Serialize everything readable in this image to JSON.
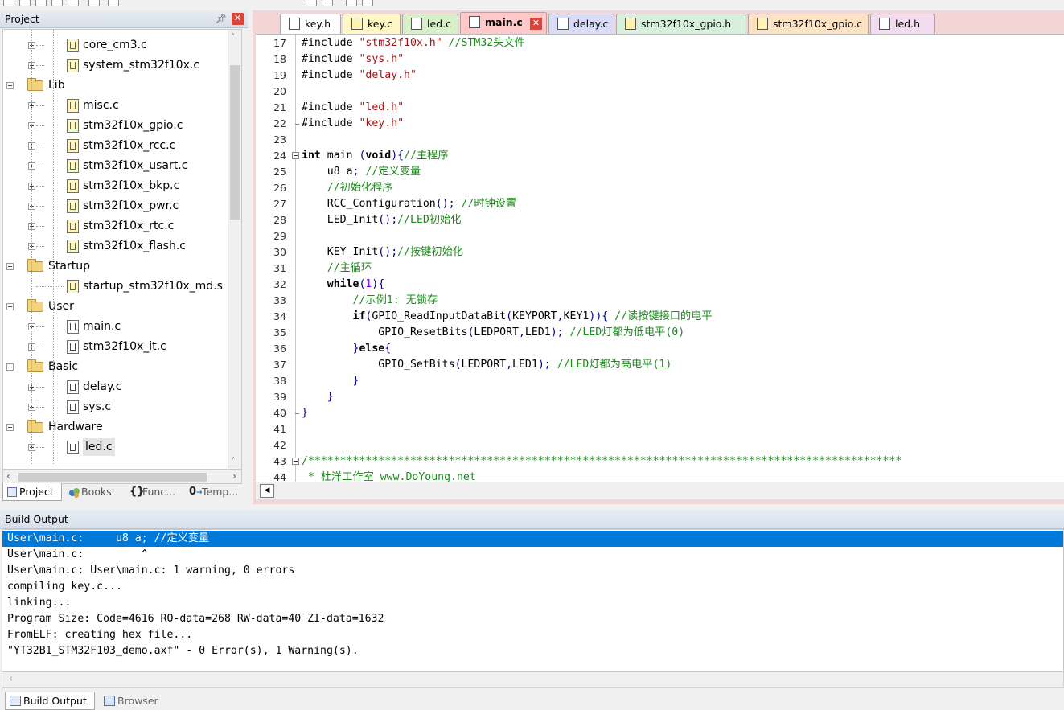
{
  "project_panel": {
    "title": "Project",
    "tree": [
      {
        "label": "core_cm3.c",
        "kind": "file",
        "icon": "config-file-icon"
      },
      {
        "label": "system_stm32f10x.c",
        "kind": "file",
        "icon": "config-file-icon"
      },
      {
        "label": "Lib",
        "kind": "group",
        "icon": "folder-icon"
      },
      {
        "label": "misc.c",
        "kind": "file",
        "icon": "config-file-icon"
      },
      {
        "label": "stm32f10x_gpio.c",
        "kind": "file",
        "icon": "config-file-icon"
      },
      {
        "label": "stm32f10x_rcc.c",
        "kind": "file",
        "icon": "config-file-icon"
      },
      {
        "label": "stm32f10x_usart.c",
        "kind": "file",
        "icon": "config-file-icon"
      },
      {
        "label": "stm32f10x_bkp.c",
        "kind": "file",
        "icon": "config-file-icon"
      },
      {
        "label": "stm32f10x_pwr.c",
        "kind": "file",
        "icon": "config-file-icon"
      },
      {
        "label": "stm32f10x_rtc.c",
        "kind": "file",
        "icon": "config-file-icon"
      },
      {
        "label": "stm32f10x_flash.c",
        "kind": "file",
        "icon": "config-file-icon"
      },
      {
        "label": "Startup",
        "kind": "group",
        "icon": "folder-icon"
      },
      {
        "label": "startup_stm32f10x_md.s",
        "kind": "file",
        "icon": "config-file-icon"
      },
      {
        "label": "User",
        "kind": "group",
        "icon": "folder-icon"
      },
      {
        "label": "main.c",
        "kind": "file",
        "icon": "c-file-icon"
      },
      {
        "label": "stm32f10x_it.c",
        "kind": "file",
        "icon": "c-file-icon"
      },
      {
        "label": "Basic",
        "kind": "group",
        "icon": "folder-icon"
      },
      {
        "label": "delay.c",
        "kind": "file",
        "icon": "c-file-icon"
      },
      {
        "label": "sys.c",
        "kind": "file",
        "icon": "c-file-icon"
      },
      {
        "label": "Hardware",
        "kind": "group",
        "icon": "folder-icon"
      },
      {
        "label": "led.c",
        "kind": "file",
        "icon": "c-file-icon",
        "selected": true
      }
    ],
    "tabs": [
      "Project",
      "Books",
      "Func...",
      "Temp..."
    ]
  },
  "editor": {
    "tabs": [
      {
        "label": "key.h",
        "color": "#ffffff"
      },
      {
        "label": "key.c",
        "color": "#fff8c4"
      },
      {
        "label": "led.c",
        "color": "#d8f0c8"
      },
      {
        "label": "main.c",
        "color": "#ffc9c9",
        "active": true
      },
      {
        "label": "delay.c",
        "color": "#d9dcf7"
      },
      {
        "label": "stm32f10x_gpio.h",
        "color": "#d6f0dc"
      },
      {
        "label": "stm32f10x_gpio.c",
        "color": "#fde2c4"
      },
      {
        "label": "led.h",
        "color": "#f3dcef"
      }
    ],
    "lines": [
      {
        "n": "17",
        "text": "#include \"stm32f10x.h\" //STM32头文件"
      },
      {
        "n": "18",
        "text": "#include \"sys.h\""
      },
      {
        "n": "19",
        "text": "#include \"delay.h\""
      },
      {
        "n": "20",
        "text": ""
      },
      {
        "n": "21",
        "text": "#include \"led.h\""
      },
      {
        "n": "22",
        "text": "#include \"key.h\""
      },
      {
        "n": "23",
        "text": ""
      },
      {
        "n": "24",
        "text": "int main (void){//主程序"
      },
      {
        "n": "25",
        "text": "    u8 a; //定义变量"
      },
      {
        "n": "26",
        "text": "    //初始化程序"
      },
      {
        "n": "27",
        "text": "    RCC_Configuration(); //时钟设置"
      },
      {
        "n": "28",
        "text": "    LED_Init();//LED初始化"
      },
      {
        "n": "29",
        "text": ""
      },
      {
        "n": "30",
        "text": "    KEY_Init();//按键初始化"
      },
      {
        "n": "31",
        "text": "    //主循环"
      },
      {
        "n": "32",
        "text": "    while(1){"
      },
      {
        "n": "33",
        "text": "        //示例1: 无锁存"
      },
      {
        "n": "34",
        "text": "        if(GPIO_ReadInputDataBit(KEYPORT,KEY1)){ //读按键接口的电平"
      },
      {
        "n": "35",
        "text": "            GPIO_ResetBits(LEDPORT,LED1); //LED灯都为低电平(0)"
      },
      {
        "n": "36",
        "text": "        }else{"
      },
      {
        "n": "37",
        "text": "            GPIO_SetBits(LEDPORT,LED1); //LED灯都为高电平(1)"
      },
      {
        "n": "38",
        "text": "        }"
      },
      {
        "n": "39",
        "text": "    }"
      },
      {
        "n": "40",
        "text": "}"
      },
      {
        "n": "41",
        "text": ""
      },
      {
        "n": "42",
        "text": ""
      },
      {
        "n": "43",
        "text": "/*********************************************************************************************"
      },
      {
        "n": "44",
        "text": " * 杜洋工作室 www.DoYoung.net"
      }
    ]
  },
  "build_output": {
    "title": "Build Output",
    "lines": [
      "User\\main.c:     u8 a; //定义变量",
      "User\\main.c:         ^",
      "User\\main.c: User\\main.c: 1 warning, 0 errors",
      "compiling key.c...",
      "linking...",
      "Program Size: Code=4616 RO-data=268 RW-data=40 ZI-data=1632",
      "FromELF: creating hex file...",
      "\"YT32B1_STM32F103_demo.axf\" - 0 Error(s), 1 Warning(s)."
    ],
    "tabs": [
      "Build Output",
      "Browser"
    ]
  }
}
